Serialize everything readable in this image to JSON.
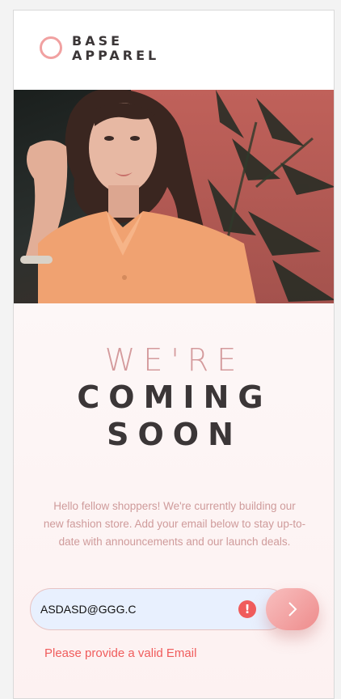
{
  "brand": {
    "line1": "BASE",
    "line2": "APPAREL"
  },
  "hero": {
    "image": "woman-in-peach-shirt-photo"
  },
  "headline": {
    "light": "WE'RE",
    "bold_line1": "COMING",
    "bold_line2": "SOON"
  },
  "description": "Hello fellow shoppers! We're currently building our new fashion store. Add your email below to stay up-to-date with announcements and our launch deals.",
  "form": {
    "email_value": "ASDASD@GGG.C",
    "error_icon": "!",
    "error_message": "Please provide a valid Email",
    "submit_icon": "chevron-right-icon"
  },
  "colors": {
    "accent": "#f1a1a1",
    "text_dark": "#3b3637",
    "text_pink": "#cf9b9b",
    "error": "#f05c5c",
    "input_bg": "#e8f0fe"
  }
}
